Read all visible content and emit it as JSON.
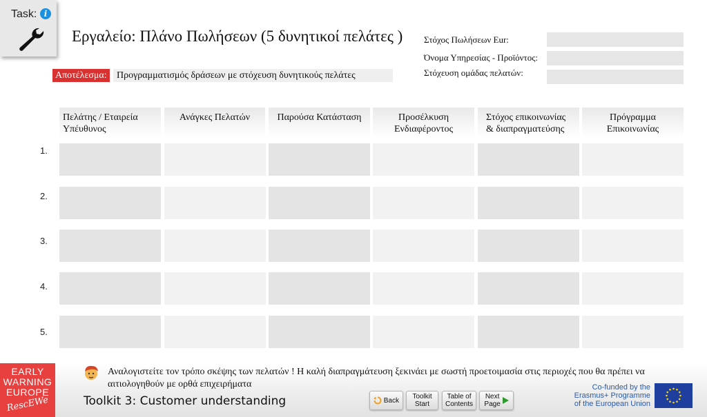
{
  "task": {
    "label": "Task:",
    "info_glyph": "i",
    "icon": "wrench-icon"
  },
  "title": "Εργαλείο: Πλάνο Πωλήσεων (5 δυνητικοί πελάτες )",
  "result": {
    "tag": "Αποτέλεσμα:",
    "text": "Προγραμματισμός δράσεων με στόχευση  δυνητικούς πελάτες"
  },
  "fields": [
    {
      "label": "Στόχος Πωλήσεων Eur:",
      "value": ""
    },
    {
      "label": "Όνομα Υπηρεσίας - Προϊόντος:",
      "value": ""
    },
    {
      "label": "Στόχευση ομάδας πελατών:",
      "value": ""
    }
  ],
  "table": {
    "columns": [
      {
        "line1": "Πελάτης /  Εταιρεία",
        "line2": "Υπέυθυνος"
      },
      {
        "line1": "Ανάγκες Πελατών",
        "line2": ""
      },
      {
        "line1": "Παρούσα Κατάσταση",
        "line2": ""
      },
      {
        "line1": "Προσέλκυση",
        "line2": "Ενδιαφέροντος"
      },
      {
        "line1": "Στόχος επικοινωνίας",
        "line2": "& διαπραγματεύσης"
      },
      {
        "line1": "Πρόγραμμα",
        "line2": "Επικοινωνίας"
      }
    ],
    "rows": [
      "1.",
      "2.",
      "3.",
      "4.",
      "5."
    ]
  },
  "footer": {
    "logo": {
      "line1": "EARLY",
      "line2": "WARNING",
      "line3": "EUROPE",
      "line4": "RescEWe"
    },
    "tip": "Αναλογιστείτε τον τρόπο σκέψης των πελατών ! Η καλή διαπραγμάτευση ξεκινάει με σωστή προετοιμασία στις περιοχές που θα πρέπει να αιτιολογηθούν με ορθά επιχειρήματα",
    "toolkit": "Toolkit 3: Customer understanding",
    "nav": {
      "back": "Back",
      "toolkit_start_1": "Toolkit",
      "toolkit_start_2": "Start",
      "toc_1": "Table of",
      "toc_2": "Contents",
      "next_1": "Next",
      "next_2": "Page"
    },
    "funding": {
      "line1": "Co-funded by the",
      "line2": "Erasmus+ Programme",
      "line3": "of the European Union"
    }
  },
  "colors": {
    "accent_red": "#d9312f",
    "logo_red": "#e8403f",
    "eu_blue": "#1f3f9e",
    "info_blue": "#1b8fe0",
    "next_green": "#2e9a2e",
    "back_orange": "#f0a01a"
  }
}
